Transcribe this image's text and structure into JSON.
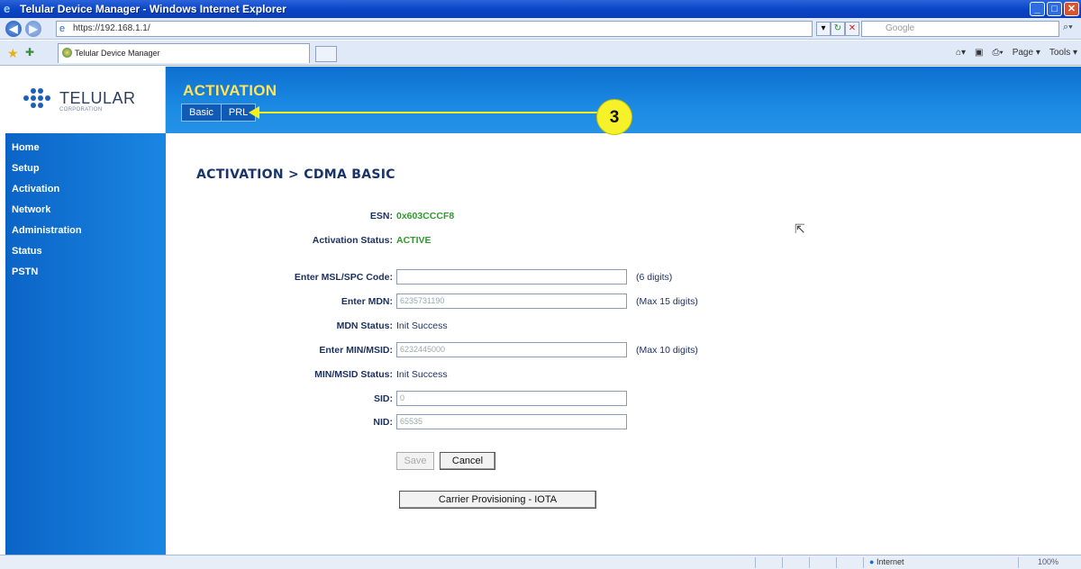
{
  "window": {
    "title": "Telular Device Manager - Windows Internet Explorer",
    "url": "https://192.168.1.1/",
    "search_placeholder": "Google",
    "tab_label": "Telular Device Manager",
    "command_bar": [
      "Page ▾",
      "Tools ▾"
    ]
  },
  "header": {
    "logo_text": "TELULAR",
    "logo_sub": "CORPORATION",
    "section_title": "ACTIVATION",
    "subtabs": [
      {
        "label": "Basic"
      },
      {
        "label": "PRL"
      }
    ]
  },
  "annotation": {
    "badge": "3"
  },
  "sidebar": {
    "items": [
      {
        "label": "Home"
      },
      {
        "label": "Setup"
      },
      {
        "label": "Activation"
      },
      {
        "label": "Network"
      },
      {
        "label": "Administration"
      },
      {
        "label": "Status"
      },
      {
        "label": "PSTN"
      }
    ]
  },
  "main": {
    "heading": "ACTIVATION > CDMA BASIC",
    "esn_label": "ESN:",
    "esn_value": "0x603CCCF8",
    "activation_status_label": "Activation Status:",
    "activation_status_value": "ACTIVE",
    "msl_label": "Enter MSL/SPC Code:",
    "msl_value": "",
    "msl_hint": "(6 digits)",
    "mdn_label": "Enter MDN:",
    "mdn_value": "6235731190",
    "mdn_hint": "(Max 15 digits)",
    "mdn_status_label": "MDN Status:",
    "mdn_status_value": "Init Success",
    "min_label": "Enter MIN/MSID:",
    "min_value": "6232445000",
    "min_hint": "(Max 10 digits)",
    "min_status_label": "MIN/MSID Status:",
    "min_status_value": "Init Success",
    "sid_label": "SID:",
    "sid_value": "0",
    "nid_label": "NID:",
    "nid_value": "65535",
    "save_label": "Save",
    "cancel_label": "Cancel",
    "otasp_label": "Carrier Provisioning - IOTA"
  },
  "statusbar": {
    "zone": "Internet",
    "zoom": "100%"
  }
}
